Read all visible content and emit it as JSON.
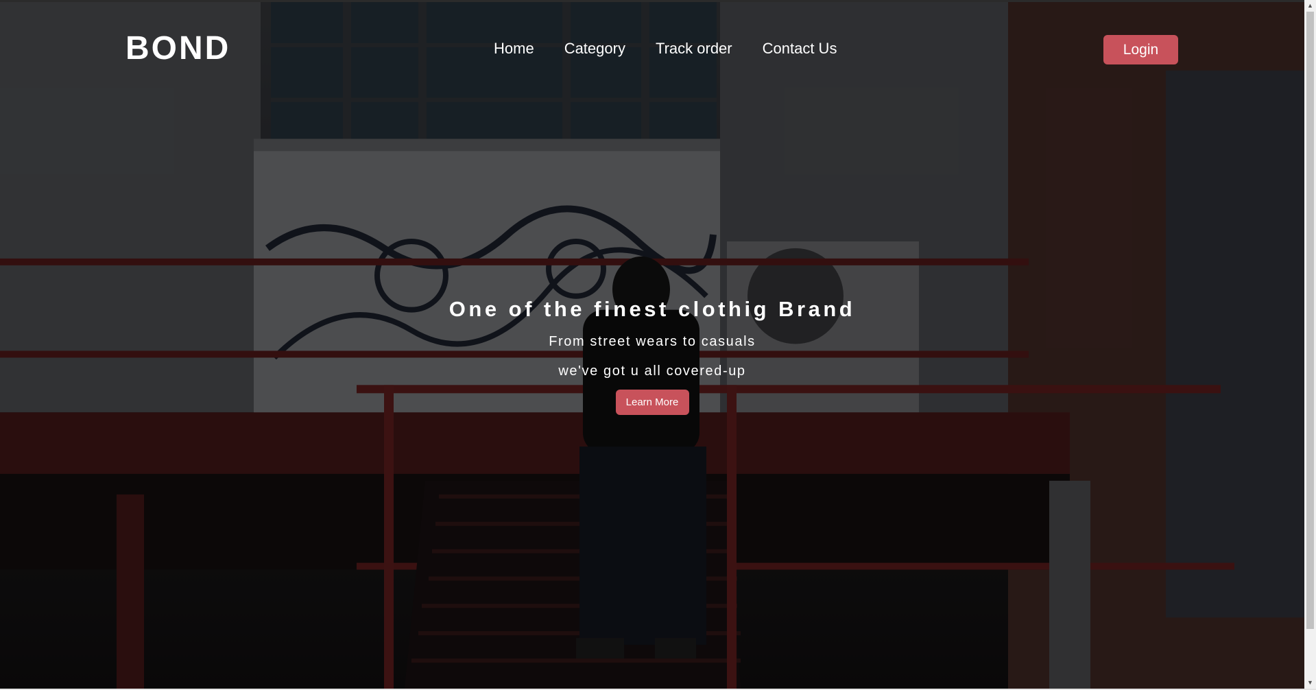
{
  "brand": {
    "logo_text": "BOND"
  },
  "nav": {
    "items": [
      {
        "label": "Home"
      },
      {
        "label": "Category"
      },
      {
        "label": "Track order"
      },
      {
        "label": "Contact Us"
      }
    ],
    "login_label": "Login"
  },
  "hero": {
    "title": "One of the finest clothig Brand",
    "subtitle": "From street wears to casuals",
    "subtitle2": "we've got u all covered-up",
    "cta_label": "Learn More"
  },
  "colors": {
    "accent": "#c8525b",
    "text": "#ffffff",
    "overlay": "#000000"
  }
}
